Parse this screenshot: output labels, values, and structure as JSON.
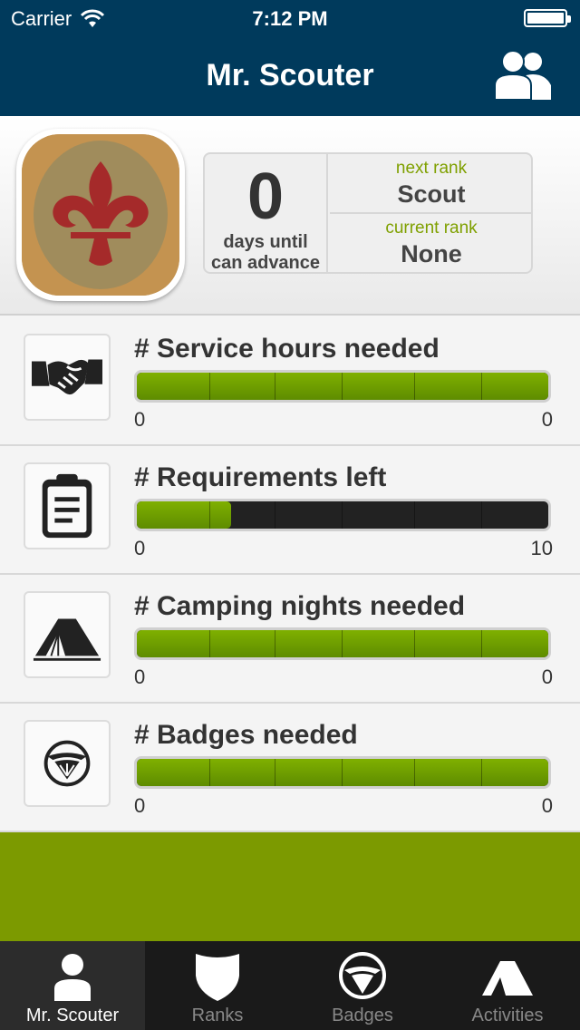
{
  "status": {
    "carrier": "Carrier",
    "time": "7:12 PM"
  },
  "nav": {
    "title": "Mr. Scouter",
    "right_icon": "people-icon"
  },
  "summary": {
    "days_value": "0",
    "days_label_line1": "days until",
    "days_label_line2": "can advance",
    "next_rank_caption": "next rank",
    "next_rank": "Scout",
    "current_rank_caption": "current rank",
    "current_rank": "None"
  },
  "progress": [
    {
      "title": "# Service hours needed",
      "icon": "handshake-icon",
      "min": "0",
      "max": "0",
      "fraction": 1.0
    },
    {
      "title": "# Requirements left",
      "icon": "clipboard-icon",
      "min": "0",
      "max": "10",
      "fraction": 0.23
    },
    {
      "title": "# Camping nights needed",
      "icon": "tent-icon",
      "min": "0",
      "max": "0",
      "fraction": 1.0
    },
    {
      "title": "# Badges needed",
      "icon": "eagle-shield-icon",
      "min": "0",
      "max": "0",
      "fraction": 1.0
    }
  ],
  "tabs": [
    {
      "label": "Mr. Scouter",
      "icon": "person-icon",
      "active": true
    },
    {
      "label": "Ranks",
      "icon": "shield-icon",
      "active": false
    },
    {
      "label": "Badges",
      "icon": "eagle-shield-icon",
      "active": false
    },
    {
      "label": "Activities",
      "icon": "tent-icon",
      "active": false
    }
  ],
  "colors": {
    "nav_bg": "#003a5c",
    "accent_green": "#7c9a00",
    "rank_caption": "#7fa000"
  }
}
